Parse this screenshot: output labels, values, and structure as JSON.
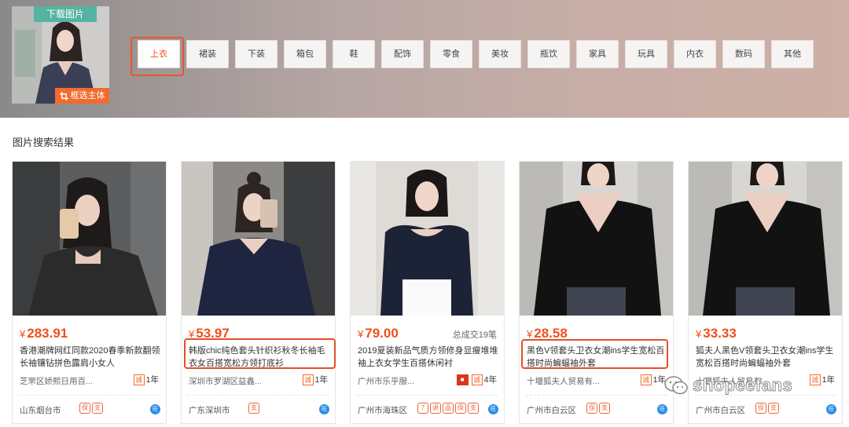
{
  "header": {
    "download_label": "下载图片",
    "crop_label": "框选主体"
  },
  "categories": [
    {
      "label": "上衣",
      "active": true
    },
    {
      "label": "裙装"
    },
    {
      "label": "下装"
    },
    {
      "label": "箱包"
    },
    {
      "label": "鞋"
    },
    {
      "label": "配饰"
    },
    {
      "label": "零食"
    },
    {
      "label": "美妆"
    },
    {
      "label": "瓶饮"
    },
    {
      "label": "家具"
    },
    {
      "label": "玩具"
    },
    {
      "label": "内衣"
    },
    {
      "label": "数码"
    },
    {
      "label": "其他"
    }
  ],
  "results_title": "图片搜索结果",
  "products": [
    {
      "price_symbol": "¥",
      "price": "283.91",
      "sold": "",
      "title": "香港潮牌网红同款2020春季新款翻领长袖镶钻拼色露肩小女人",
      "seller": "芝罘区娇熙日用百...",
      "years": "1年",
      "location": "山东烟台市",
      "tags": [
        "保",
        "支"
      ]
    },
    {
      "price_symbol": "¥",
      "price": "53.97",
      "sold": "",
      "title": "韩版chic纯色套头针织衫秋冬长袖毛衣女百搭宽松方领打底衫",
      "seller": "深圳市罗湖区益鑫...",
      "years": "1年",
      "location": "广东深圳市",
      "tags": [
        "支"
      ]
    },
    {
      "price_symbol": "¥",
      "price": "79.00",
      "sold": "总成交19笔",
      "title": "2019夏装新品气质方领修身显瘦堆堆袖上衣女学生百搭休闲衬",
      "seller": "广州市乐乎服...",
      "years": "4年",
      "location": "广州市海珠区",
      "tags": [
        "7",
        "退",
        "品",
        "保",
        "支"
      ]
    },
    {
      "price_symbol": "¥",
      "price": "28.58",
      "sold": "",
      "title": "黑色V领套头卫衣女潮ins学生宽松百搭时尚蝙蝠袖外套",
      "seller": "十堰狐夫人贸易有...",
      "years": "1年",
      "location": "广州市白云区",
      "tags": [
        "保",
        "支"
      ]
    },
    {
      "price_symbol": "¥",
      "price": "33.33",
      "sold": "",
      "title": "狐夫人黑色V领套头卫衣女潮ins学生宽松百搭时尚蝙蝠袖外套",
      "seller": "十堰狐夫人贸易有...",
      "years": "1年",
      "location": "广州市白云区",
      "tags": [
        "保",
        "支"
      ]
    }
  ],
  "badges": {
    "cheng": "诚",
    "wangwang": "旺"
  },
  "watermark": "shopeefans",
  "colors": {
    "accent": "#f14f1a",
    "highlight": "#e4502a",
    "download_badge": "#54b4a1",
    "crop_badge": "#f26b2e"
  }
}
